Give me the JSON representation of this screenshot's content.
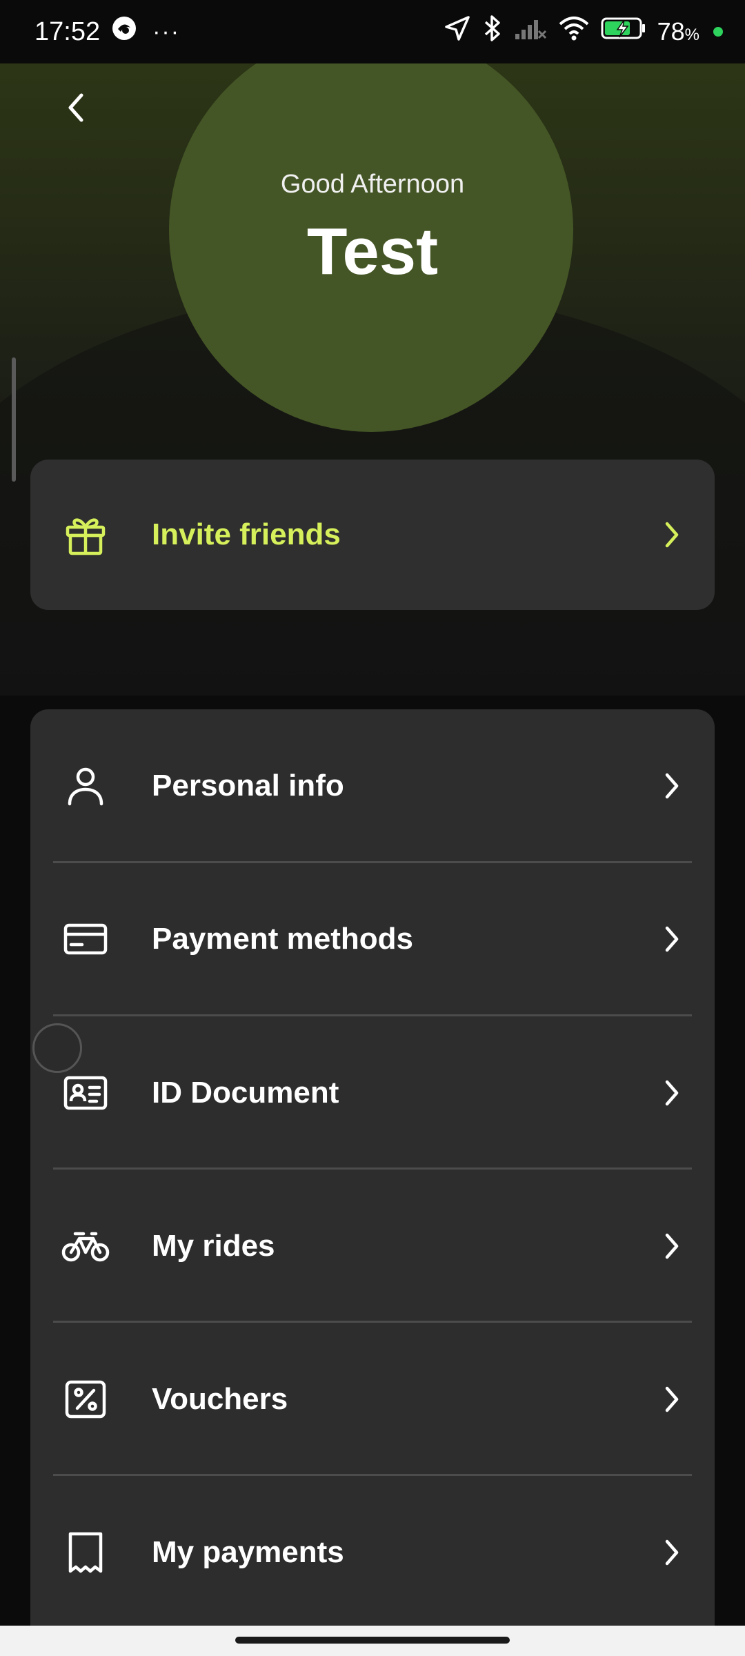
{
  "status_bar": {
    "time": "17:52",
    "overflow": "···",
    "battery_percent": "78",
    "battery_unit": "%",
    "icons": [
      "app-notification-icon",
      "location-arrow-icon",
      "bluetooth-icon",
      "signal-icon",
      "wifi-icon",
      "battery-charging-icon"
    ]
  },
  "header": {
    "back_icon": "chevron-left-icon",
    "greeting": "Good Afternoon",
    "user_name": "Test"
  },
  "invite": {
    "label": "Invite friends",
    "icon": "gift-icon"
  },
  "menu": {
    "items": [
      {
        "label": "Personal info",
        "icon": "user-icon"
      },
      {
        "label": "Payment methods",
        "icon": "credit-card-icon"
      },
      {
        "label": "ID Document",
        "icon": "id-card-icon"
      },
      {
        "label": "My rides",
        "icon": "bicycle-icon"
      },
      {
        "label": "Vouchers",
        "icon": "percent-voucher-icon"
      },
      {
        "label": "My payments",
        "icon": "receipt-icon"
      }
    ]
  },
  "colors": {
    "accent": "#d6f05b",
    "card": "#2d2d2d",
    "hero_circle": "#455626",
    "background": "#0b0b0b"
  }
}
